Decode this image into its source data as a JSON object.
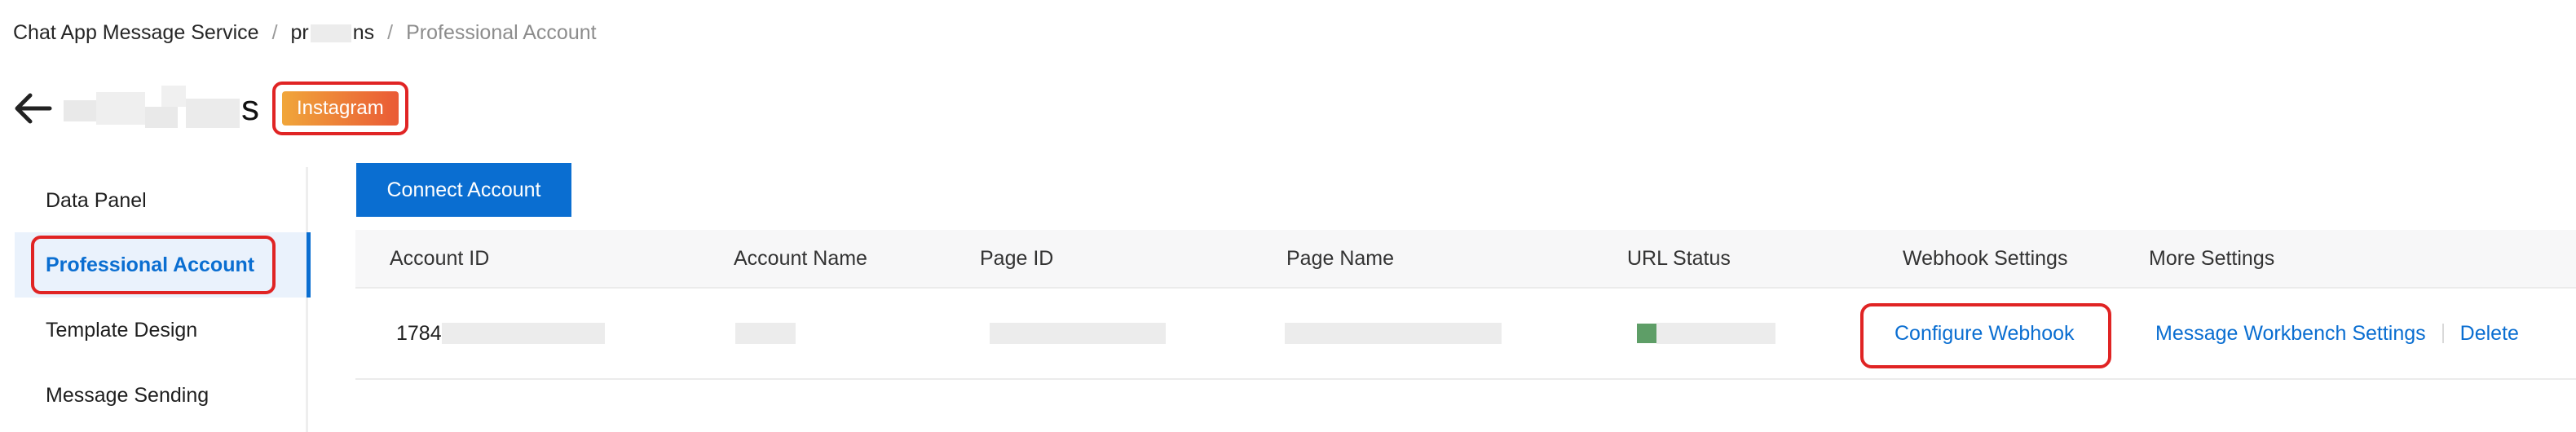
{
  "breadcrumb": {
    "root": "Chat App Message Service",
    "middle_prefix": "pr",
    "middle_suffix": "ns",
    "current": "Professional Account"
  },
  "header": {
    "title_suffix": "s",
    "badge": "Instagram"
  },
  "sidebar": {
    "items": [
      {
        "label": "Data Panel"
      },
      {
        "label": "Professional Account",
        "active": true
      },
      {
        "label": "Template Design"
      },
      {
        "label": "Message Sending"
      }
    ]
  },
  "toolbar": {
    "connect_label": "Connect Account"
  },
  "table": {
    "columns": [
      "Account ID",
      "Account Name",
      "Page ID",
      "Page Name",
      "URL Status",
      "Webhook Settings",
      "More Settings"
    ],
    "rows": [
      {
        "account_id_prefix": "1784",
        "configure_webhook": "Configure Webhook",
        "workbench_settings": "Message Workbench Settings",
        "delete": "Delete"
      }
    ]
  },
  "colors": {
    "accent": "#0a6ed1",
    "highlight": "#e02424",
    "badge_start": "#f0a63a",
    "badge_end": "#ea5a36"
  },
  "icons": {
    "back": "arrow-left-icon"
  }
}
